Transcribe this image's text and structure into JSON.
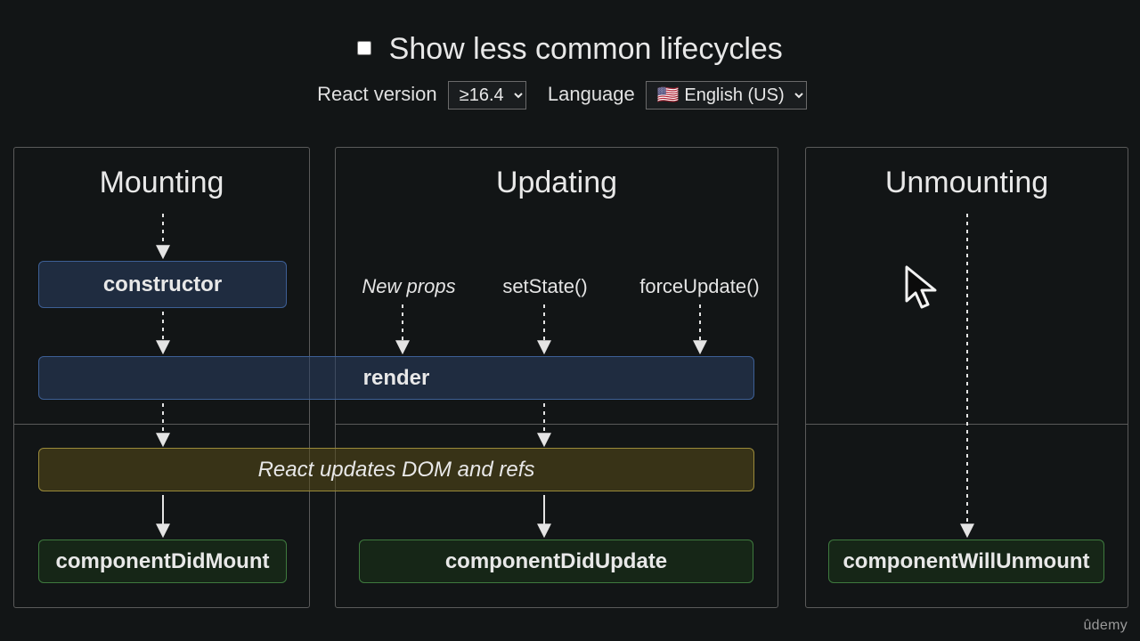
{
  "header": {
    "checkbox_label": "Show less common lifecycles",
    "react_version_label": "React version",
    "react_version_value": "≥16.4",
    "language_label": "Language",
    "language_value": "🇺🇸 English (US)"
  },
  "columns": {
    "mounting": {
      "title": "Mounting"
    },
    "updating": {
      "title": "Updating",
      "triggers": [
        "New props",
        "setState()",
        "forceUpdate()"
      ]
    },
    "unmounting": {
      "title": "Unmounting"
    }
  },
  "boxes": {
    "constructor": "constructor",
    "render": "render",
    "dom_update": "React updates DOM and refs",
    "didMount": "componentDidMount",
    "didUpdate": "componentDidUpdate",
    "willUnmount": "componentWillUnmount"
  },
  "brand": "ûdemy"
}
